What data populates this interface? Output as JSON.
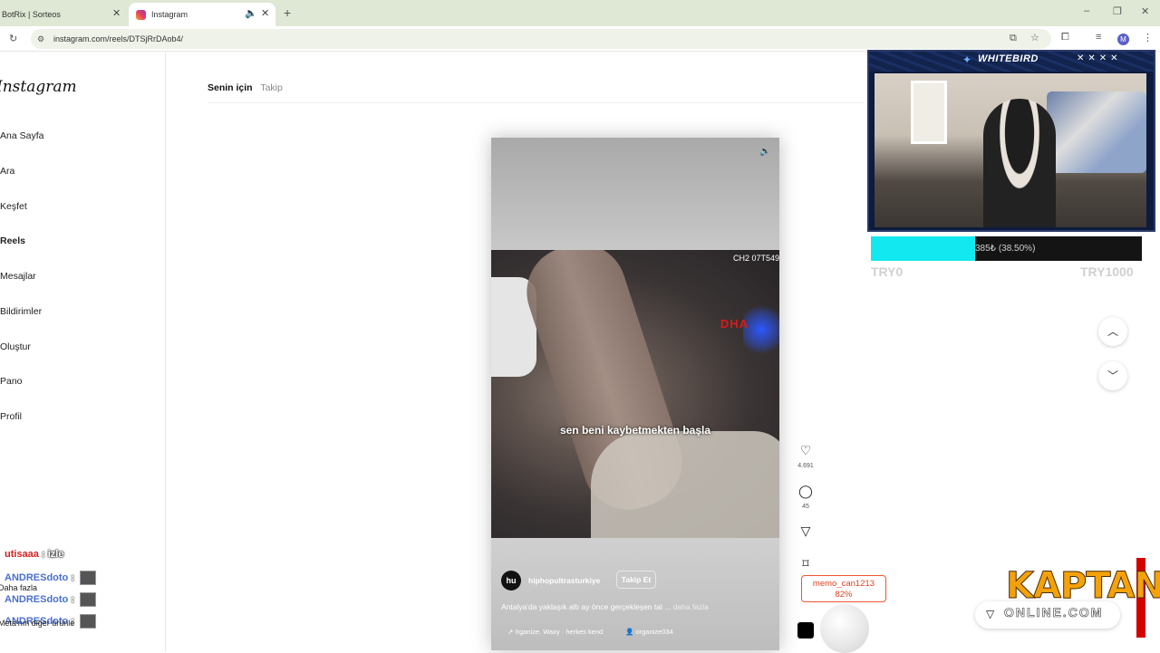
{
  "browser": {
    "tabs": [
      {
        "title": "BotRix | Sorteos"
      },
      {
        "title": "Instagram"
      }
    ],
    "url": "instagram.com/reels/DTSjRrDAob4/",
    "profile_initial": "M"
  },
  "sidebar": {
    "logo": "Instagram",
    "items": [
      {
        "label": "Ana Sayfa"
      },
      {
        "label": "Ara"
      },
      {
        "label": "Keşfet"
      },
      {
        "label": "Reels"
      },
      {
        "label": "Mesajlar"
      },
      {
        "label": "Bildirimler"
      },
      {
        "label": "Oluştur"
      },
      {
        "label": "Pano"
      },
      {
        "label": "Profil"
      }
    ]
  },
  "feed_tabs": {
    "for_you": "Senin için",
    "following": "Takip"
  },
  "reel": {
    "overlay_label": "CH2 07T549",
    "watermark": "DHA",
    "subtitle": "sen beni kaybetmekten başla",
    "avatar_text": "hu",
    "username": "hiphopultrasturkiye",
    "follow_label": "Takip Et",
    "caption": "Antalya'da yaklaşık altı ay önce gerçekleşen tal ...",
    "more_label": "daha fazla",
    "audio": "↗ Irganize, Waxy · herkes kend",
    "collab": "organize034"
  },
  "actions": {
    "likes": "4.691",
    "comments": "45"
  },
  "stream": {
    "brand": "WHITEBIRD",
    "goal_text": "385₺ (38.50%)",
    "goal_fraction": 0.385,
    "goal_min": "TRY0",
    "goal_max": "TRY1000",
    "donor": "memo_can1213",
    "donor_pct": "82%",
    "sponsor": "KAPTAN",
    "sponsor_sub": "ONLINE.COM"
  },
  "chat": [
    {
      "user": "utisaaa",
      "msg": "izle"
    },
    {
      "user": "ANDRESdoto",
      "sub": "Daha fazla"
    },
    {
      "user": "ANDRESdoto",
      "sub": ""
    },
    {
      "user": "ANDRESdoto",
      "sub": "Meta'nın diğer ürünle"
    }
  ],
  "colors": {
    "goal_fill": "#12e8f0",
    "donor_border": "#e53",
    "sponsor": "#f4a20b"
  }
}
